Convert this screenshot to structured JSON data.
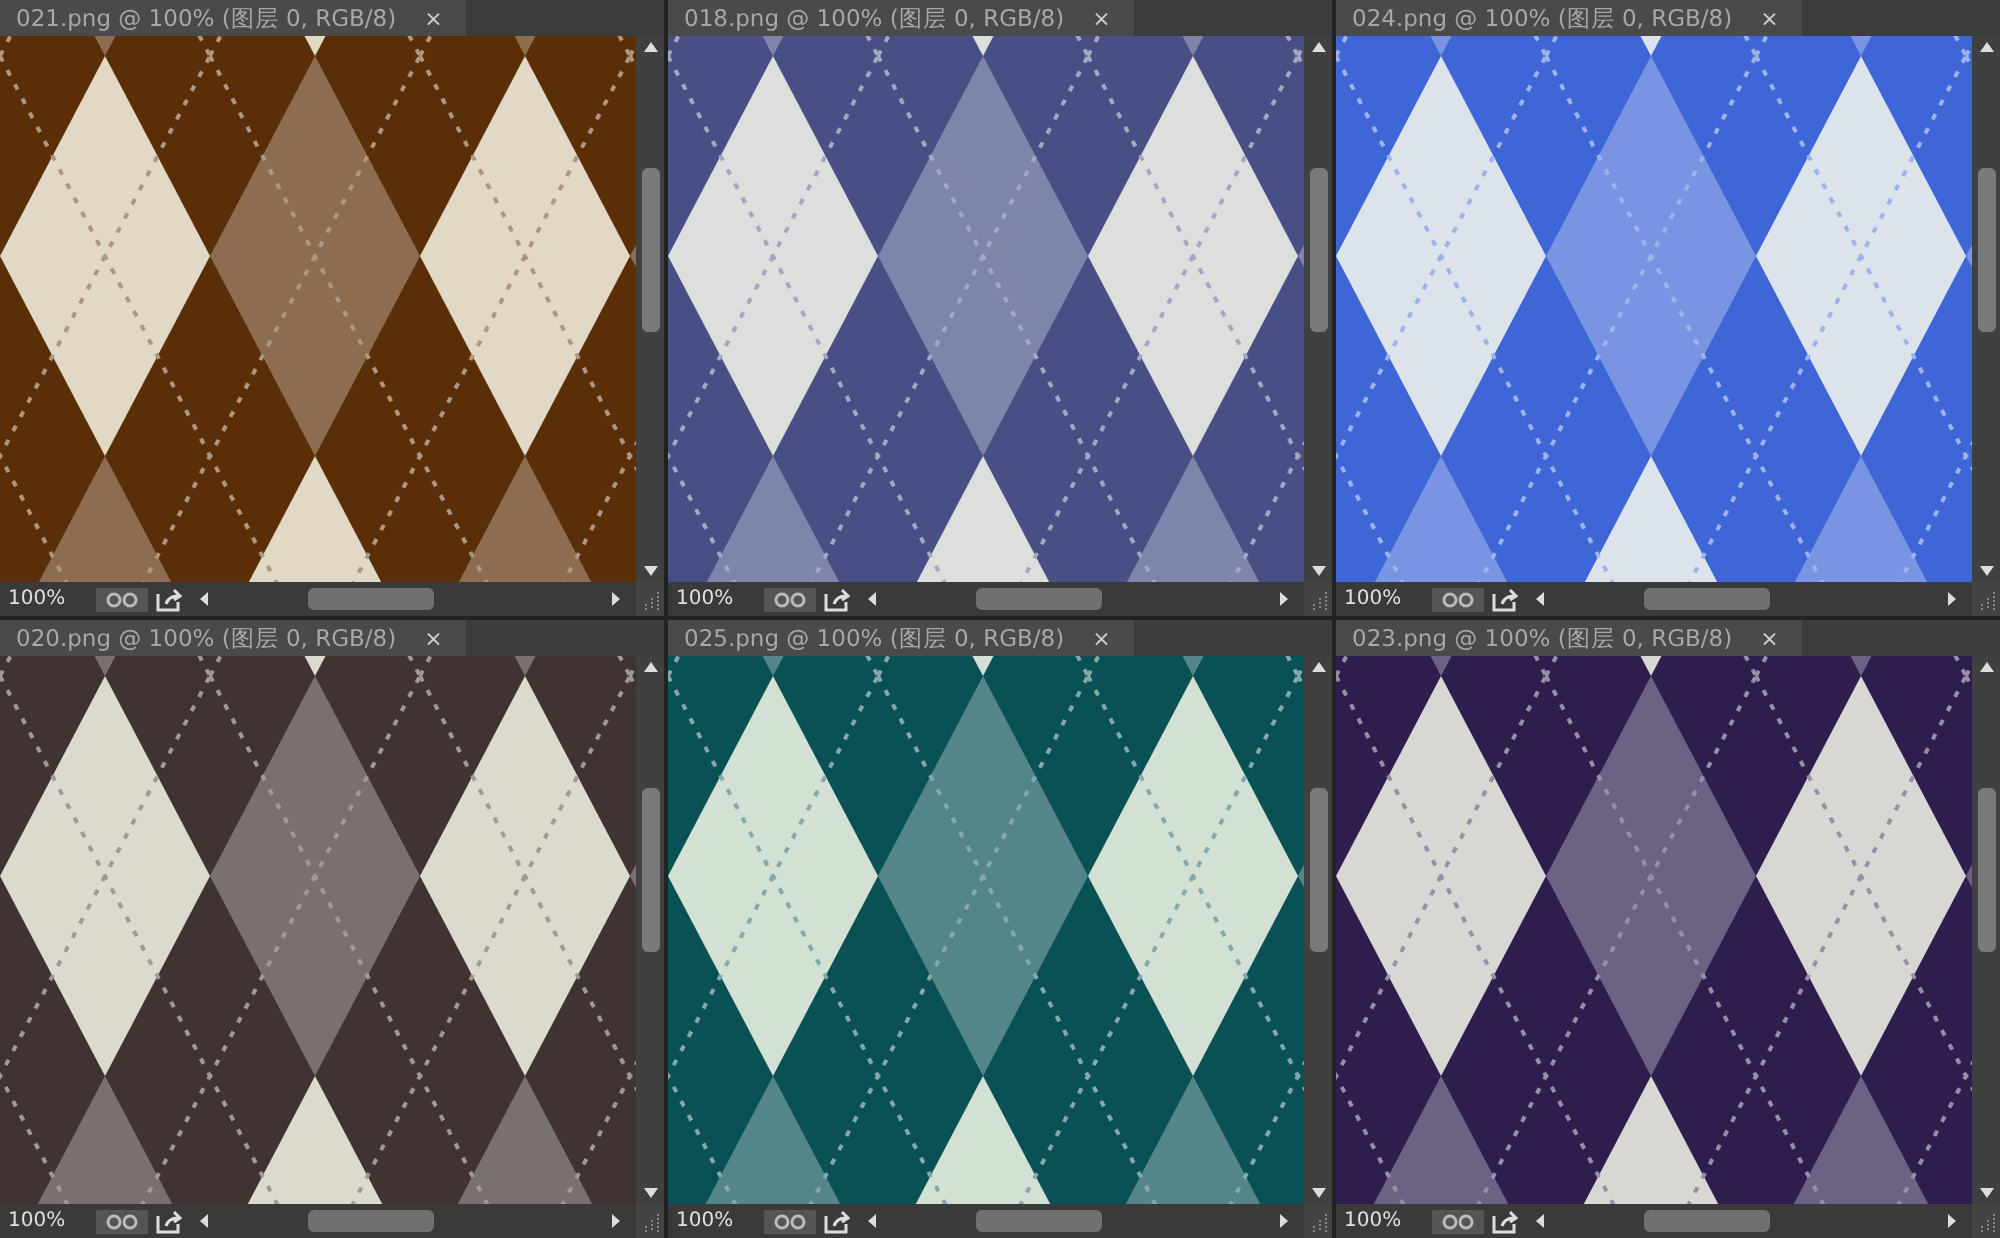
{
  "documents": [
    {
      "title": "021.png @ 100% (图层 0, RGB/8)",
      "close": "×",
      "zoom": "100%",
      "color": "#5a2e06"
    },
    {
      "title": "018.png @ 100% (图层 0, RGB/8)",
      "close": "×",
      "zoom": "100%",
      "color": "#474f85"
    },
    {
      "title": "024.png @ 100% (图层 0, RGB/8)",
      "close": "×",
      "zoom": "100%",
      "color": "#3e66d6"
    },
    {
      "title": "020.png @ 100% (图层 0, RGB/8)",
      "close": "×",
      "zoom": "100%",
      "color": "#3f3431"
    },
    {
      "title": "025.png @ 100% (图层 0, RGB/8)",
      "close": "×",
      "zoom": "100%",
      "color": "#0a5156"
    },
    {
      "title": "023.png @ 100% (图层 0, RGB/8)",
      "close": "×",
      "zoom": "100%",
      "color": "#2d1e4e"
    }
  ]
}
